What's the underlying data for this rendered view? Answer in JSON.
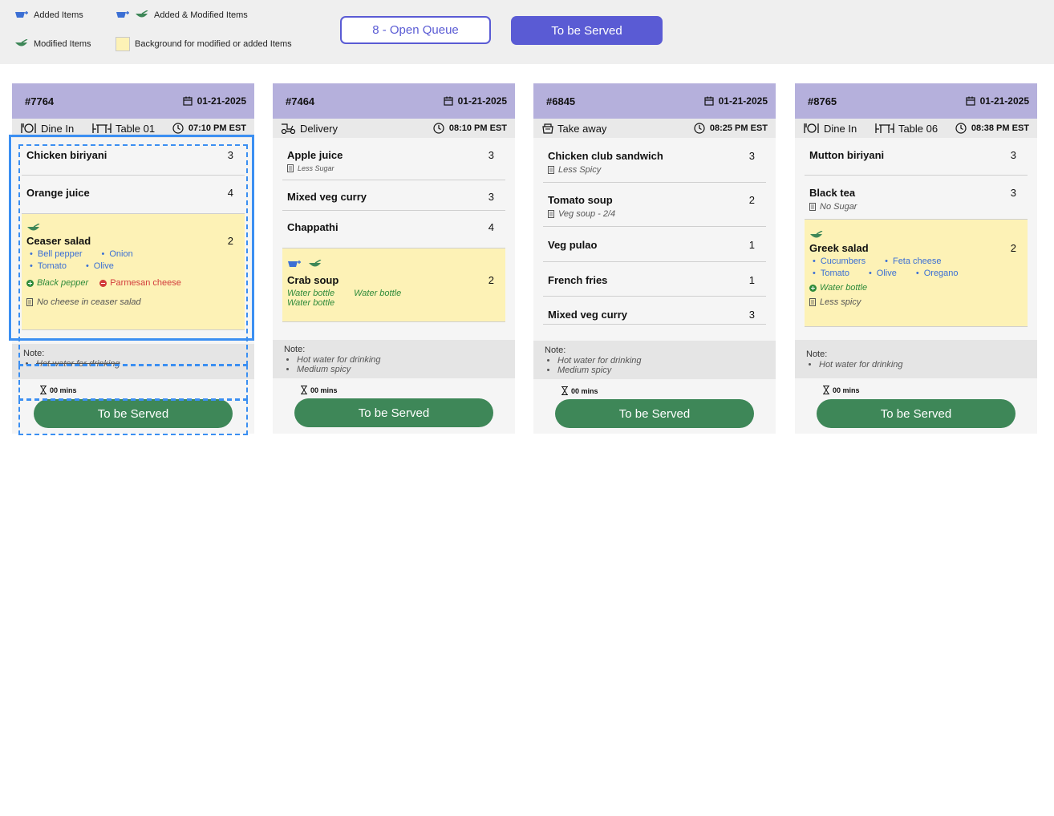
{
  "legend": {
    "added": "Added Items",
    "added_modified": "Added & Modified Items",
    "modified": "Modified Items",
    "background": "Background for modified or added Items"
  },
  "header_buttons": {
    "open_queue": "8 - Open Queue",
    "to_be_served": "To be Served"
  },
  "colors": {
    "accent": "#5a5bd4",
    "card_header": "#b5b0dc",
    "highlight": "#fdf2b6",
    "serve_button": "#3e8758",
    "modifier_text": "#3b6fd4",
    "added_text": "#2e8a3a",
    "removed_text": "#d23b3b",
    "selection": "#3b8ff2"
  },
  "cards": [
    {
      "order": "#7764",
      "date": "01-21-2025",
      "type": "Dine In",
      "type_icon": "dine-in-icon",
      "table": "Table 01",
      "time": "07:10 PM EST",
      "items": [
        {
          "name": "Chicken biriyani",
          "qty": "3"
        },
        {
          "name": "Orange juice",
          "qty": "4"
        },
        {
          "name": "Ceaser salad",
          "qty": "2",
          "highlight": true,
          "icons": [
            "modified-icon"
          ],
          "modifiers": [
            "Bell pepper",
            "Onion",
            "Tomato",
            "Olive"
          ],
          "added": "Black pepper",
          "removed": "Parmesan cheese",
          "instruction": "No cheese in ceaser salad"
        }
      ],
      "note_label": "Note:",
      "notes": [
        "Hot water for drinking"
      ],
      "timer": "00 mins",
      "serve_label": "To be Served"
    },
    {
      "order": "#7464",
      "date": "01-21-2025",
      "type": "Delivery",
      "type_icon": "delivery-icon",
      "time": "08:10 PM EST",
      "items": [
        {
          "name": "Apple juice",
          "qty": "3",
          "instruction": "Less Sugar"
        },
        {
          "name": "Mixed veg curry",
          "qty": "3"
        },
        {
          "name": "Chappathi",
          "qty": "4"
        },
        {
          "name": "Crab soup",
          "qty": "2",
          "highlight": true,
          "icons": [
            "added-icon",
            "modified-icon"
          ],
          "water": [
            "Water bottle",
            "Water bottle",
            "Water bottle"
          ]
        }
      ],
      "note_label": "Note:",
      "notes": [
        "Hot water for drinking",
        "Medium spicy"
      ],
      "timer": "00 mins",
      "serve_label": "To be Served"
    },
    {
      "order": "#6845",
      "date": "01-21-2025",
      "type": "Take away",
      "type_icon": "take-away-icon",
      "time": "08:25 PM EST",
      "items": [
        {
          "name": "Chicken club sandwich",
          "qty": "3",
          "instruction": "Less Spicy"
        },
        {
          "name": "Tomato soup",
          "qty": "2",
          "instruction": "Veg soup - 2/4"
        },
        {
          "name": "Veg pulao",
          "qty": "1"
        },
        {
          "name": "French fries",
          "qty": "1"
        },
        {
          "name": "Mixed veg curry",
          "qty": "3"
        }
      ],
      "note_label": "Note:",
      "notes": [
        "Hot water for drinking",
        "Medium spicy"
      ],
      "timer": "00 mins",
      "serve_label": "To be Served"
    },
    {
      "order": "#8765",
      "date": "01-21-2025",
      "type": "Dine In",
      "type_icon": "dine-in-icon",
      "table": "Table 06",
      "time": "08:38 PM EST",
      "items": [
        {
          "name": "Mutton biriyani",
          "qty": "3"
        },
        {
          "name": "Black tea",
          "qty": "3",
          "instruction": "No Sugar"
        },
        {
          "name": "Greek salad",
          "qty": "2",
          "highlight": true,
          "icons": [
            "modified-icon"
          ],
          "modifiers": [
            "Cucumbers",
            "Feta cheese",
            "Tomato",
            "Olive",
            "Oregano"
          ],
          "added": "Water bottle",
          "instruction": "Less spicy"
        }
      ],
      "note_label": "Note:",
      "notes": [
        "Hot water for drinking"
      ],
      "timer": "00 mins",
      "serve_label": "To be Served"
    }
  ]
}
